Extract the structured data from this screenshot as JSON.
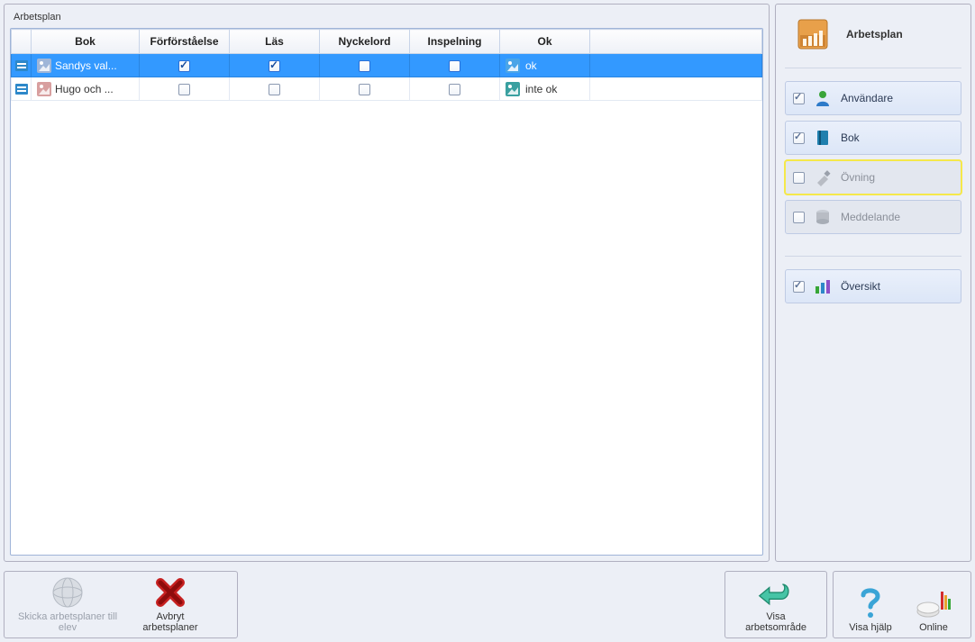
{
  "panel": {
    "title": "Arbetsplan"
  },
  "columns": {
    "c0": "",
    "c1": "Bok",
    "c2": "Förförståelse",
    "c3": "Läs",
    "c4": "Nyckelord",
    "c5": "Inspelning",
    "c6": "Ok"
  },
  "rows": [
    {
      "book": "Sandys val...",
      "c2": true,
      "c3": true,
      "c4": false,
      "c5": false,
      "okText": "ok",
      "selected": true
    },
    {
      "book": "Hugo och ...",
      "c2": false,
      "c3": false,
      "c4": false,
      "c5": false,
      "okText": "inte ok",
      "selected": false
    }
  ],
  "sidebar": {
    "title": "Arbetsplan",
    "items": [
      {
        "label": "Användare",
        "checked": true,
        "disabled": false,
        "iconColor": "#3aa53a"
      },
      {
        "label": "Bok",
        "checked": true,
        "disabled": false,
        "iconColor": "#1f7fae"
      },
      {
        "label": "Övning",
        "checked": false,
        "disabled": true,
        "iconColor": "#9aa0ab",
        "highlight": true
      },
      {
        "label": "Meddelande",
        "checked": false,
        "disabled": true,
        "iconColor": "#9aa0ab"
      }
    ],
    "overview": {
      "label": "Översikt",
      "checked": true
    }
  },
  "footer": {
    "send": "Skicka arbetsplaner till elev",
    "cancel": "Avbryt arbetsplaner",
    "workspace": "Visa arbetsområde",
    "help": "Visa hjälp",
    "online": "Online"
  }
}
